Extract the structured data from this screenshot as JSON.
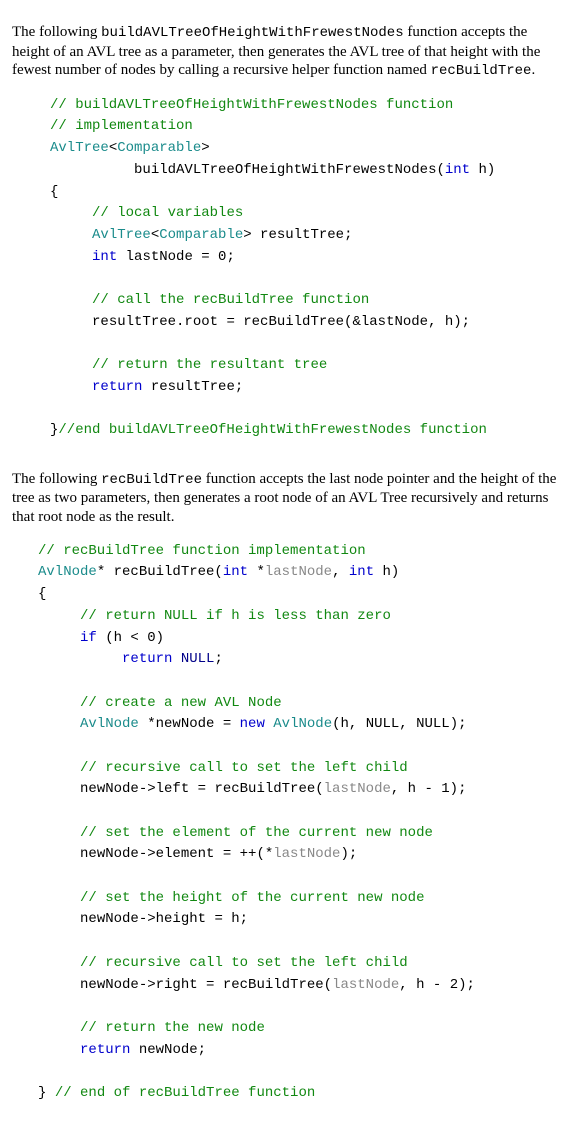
{
  "para1": {
    "pre": "The following ",
    "fn": "buildAVLTreeOfHeightWithFrewestNodes",
    "mid": " function accepts the height of an AVL tree as a parameter, then generates the AVL tree of that height with the fewest number of nodes by calling a recursive helper function named ",
    "fn2": "recBuildTree",
    "end": "."
  },
  "code1": {
    "c1": "// buildAVLTreeOfHeightWithFrewestNodes function",
    "c1b": "// implementation",
    "sigTypeA": "AvlTree",
    "sigTypeB": "Comparable",
    "sigFn": "buildAVLTreeOfHeightWithFrewestNodes",
    "sigParamType": "int",
    "sigParamName": " h",
    "c2": "// local variables",
    "declType": "AvlTree",
    "declGeneric": "Comparable",
    "declVar": " resultTree;",
    "intKw": "int",
    "lastNodeDecl": " lastNode = 0;",
    "c3": "// call the recBuildTree function",
    "call": "resultTree.root = recBuildTree(&lastNode, h);",
    "c4": "// return the resultant tree",
    "ret": "return",
    "retExpr": " resultTree;",
    "endC": "//end buildAVLTreeOfHeightWithFrewestNodes function"
  },
  "para2": {
    "pre": "The following ",
    "fn": "recBuildTree",
    "post": " function accepts the last node pointer and the height of the tree as two parameters, then generates a root node of an AVL Tree recursively and returns that root node as the result."
  },
  "code2": {
    "c0": "// recBuildTree function implementation",
    "retType": "AvlNode",
    "fnName": "* recBuildTree(",
    "p1t": "int",
    "p1n": " *",
    "p1g": "lastNode",
    "p2": ", ",
    "p2t": "int",
    "p2n": " h)",
    "c1": "// return NULL if h is less than zero",
    "ifKw": "if",
    "ifCond": " (h < 0)",
    "retKw": "return",
    "nullKw": "NULL",
    "c2": "// create a new AVL Node",
    "nodeType": "AvlNode",
    "nodeDecl": " *newNode = ",
    "newKw": "new",
    "ctorType": "AvlNode",
    "ctorArgs": "(h, NULL, NULL);",
    "c3": "// recursive call to set the left child",
    "leftA": "newNode->left = recBuildTree(",
    "leftArg": "lastNode",
    "leftB": ", h - 1);",
    "c4": "// set the element of the current new node",
    "elemA": "newNode->element = ++(*",
    "elemArg": "lastNode",
    "elemB": ");",
    "c5": "// set the height of the current new node",
    "heightLine": "newNode->height = h;",
    "c6": "// recursive call to set the left child",
    "rightA": "newNode->right = recBuildTree(",
    "rightArg": "lastNode",
    "rightB": ", h - 2);",
    "c7": "// return the new node",
    "retKw2": "return",
    "retExpr2": " newNode;",
    "endC": "// end of recBuildTree function"
  }
}
